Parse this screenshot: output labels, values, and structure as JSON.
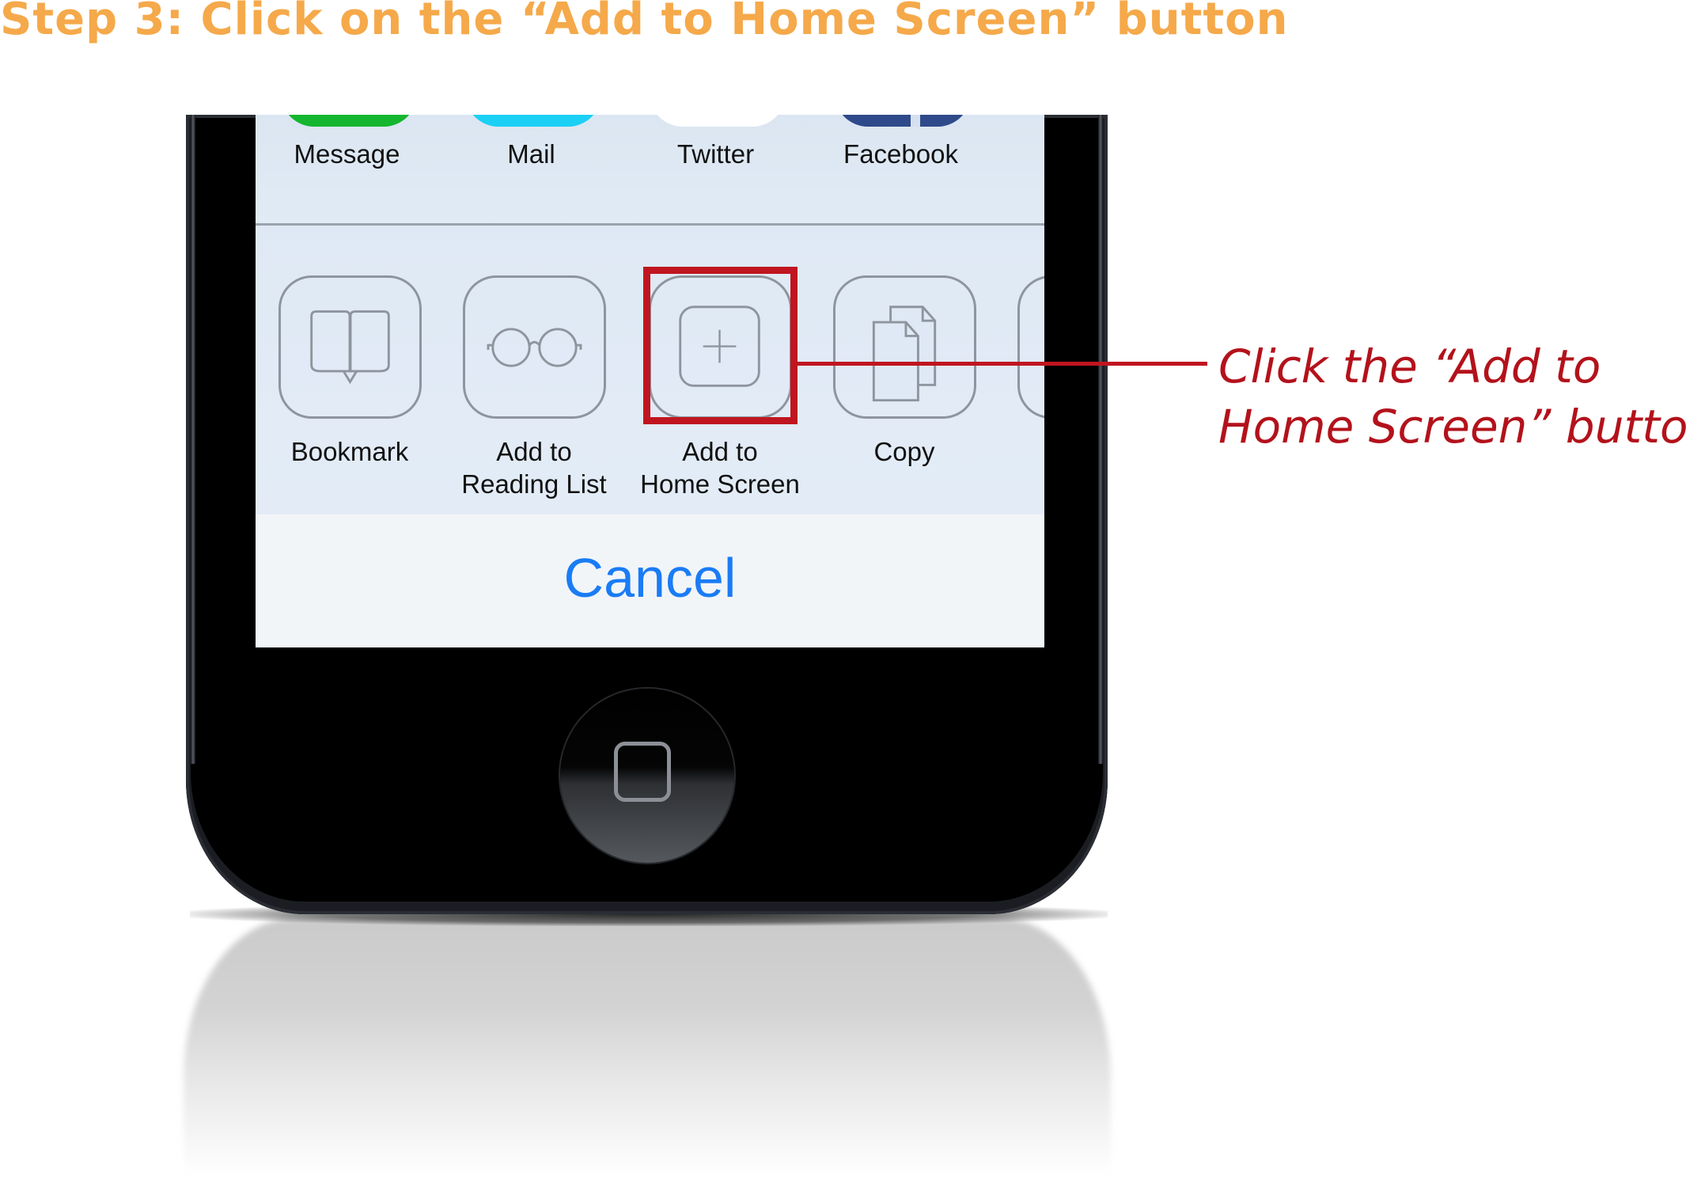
{
  "title": "Step 3: Click on the “Add to Home Screen” button",
  "share_sheet": {
    "apps": [
      {
        "label": "Message",
        "icon": "message-app-icon",
        "color": "#14B62F"
      },
      {
        "label": "Mail",
        "icon": "mail-app-icon",
        "color": "#1BD0F4"
      },
      {
        "label": "Twitter",
        "icon": "twitter-app-icon",
        "color": "#FFFFFF"
      },
      {
        "label": "Facebook",
        "icon": "facebook-app-icon",
        "color": "#2F4A8A"
      }
    ],
    "actions": [
      {
        "label_line1": "Bookmark",
        "label_line2": "",
        "icon": "bookmark-icon"
      },
      {
        "label_line1": "Add to",
        "label_line2": "Reading List",
        "icon": "glasses-icon"
      },
      {
        "label_line1": "Add to",
        "label_line2": "Home Screen",
        "icon": "add-square-icon",
        "highlighted": true
      },
      {
        "label_line1": "Copy",
        "label_line2": "",
        "icon": "copy-icon"
      }
    ],
    "cancel_label": "Cancel",
    "cancel_color": "#1A7CF5"
  },
  "annotation": {
    "line1": "Click the “Add to",
    "line2": "Home Screen” button",
    "color": "#B3121B"
  },
  "colors": {
    "title": "#F5A94A",
    "highlight": "#C01520"
  }
}
